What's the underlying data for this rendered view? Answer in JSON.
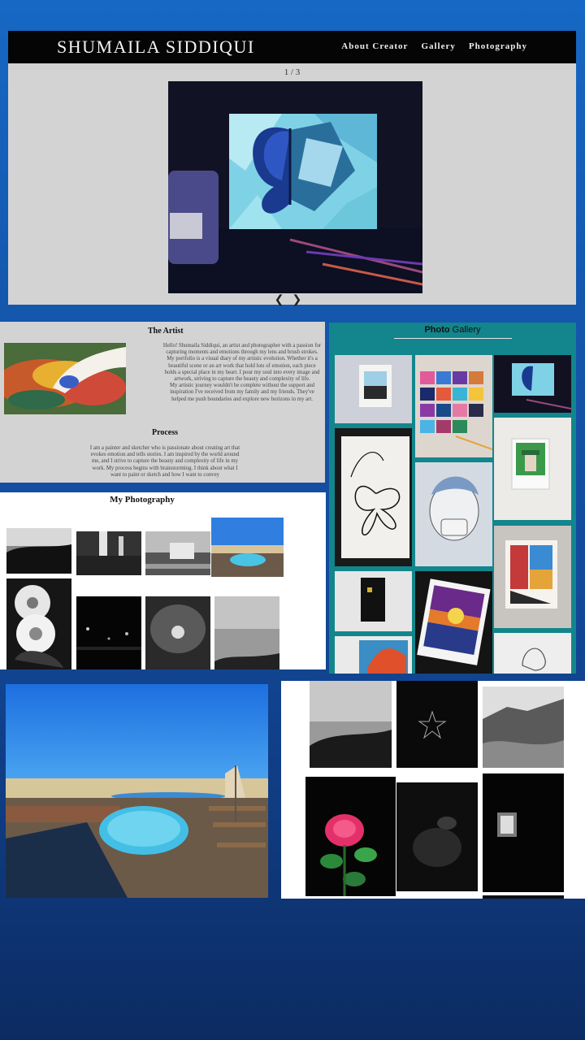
{
  "site": {
    "brand": "SHUMAILA SIDDIQUI",
    "nav": [
      "About Creator",
      "Gallery",
      "Photography"
    ]
  },
  "slideshow": {
    "counter": "1 / 3",
    "prev": "❮",
    "next": "❯"
  },
  "artist": {
    "heading": "The Artist",
    "bio": [
      "Hello! Shumaila Siddiqui, an artist and photographer with a passion for capturing moments and emotions through my lens and brush strokes.",
      "My portfolio is a visual diary of my artistic evolution. Whether it's a beautiful scene or an art work that hold lots of emotion, each piece holds a special place in my heart. I pour my soul into every image and artwork, striving to capture the beauty and complexity of life.",
      "My artistic journey wouldn't be complete without the support and inspiration I've received from my family and my friends. They've helped me push boundaries and explore new horizons in my art."
    ],
    "process_heading": "Process",
    "process_text": "I am a painter and sketcher who is passionate about creating art that evokes emotion and tells stories. I am inspired by the world around me, and I strive to capture the beauty and complexity of life in my work. My process begins with brainstorming. I think about what I want to paint or sketch and how I want to convey"
  },
  "gallery": {
    "title_bold": "Photo",
    "title_rest": " Gallery"
  },
  "photography": {
    "title": "My Photography"
  },
  "colors": {
    "teal": "#13858c",
    "panel_gray": "#d3d3d3",
    "bg_blue": "#1457ad"
  }
}
